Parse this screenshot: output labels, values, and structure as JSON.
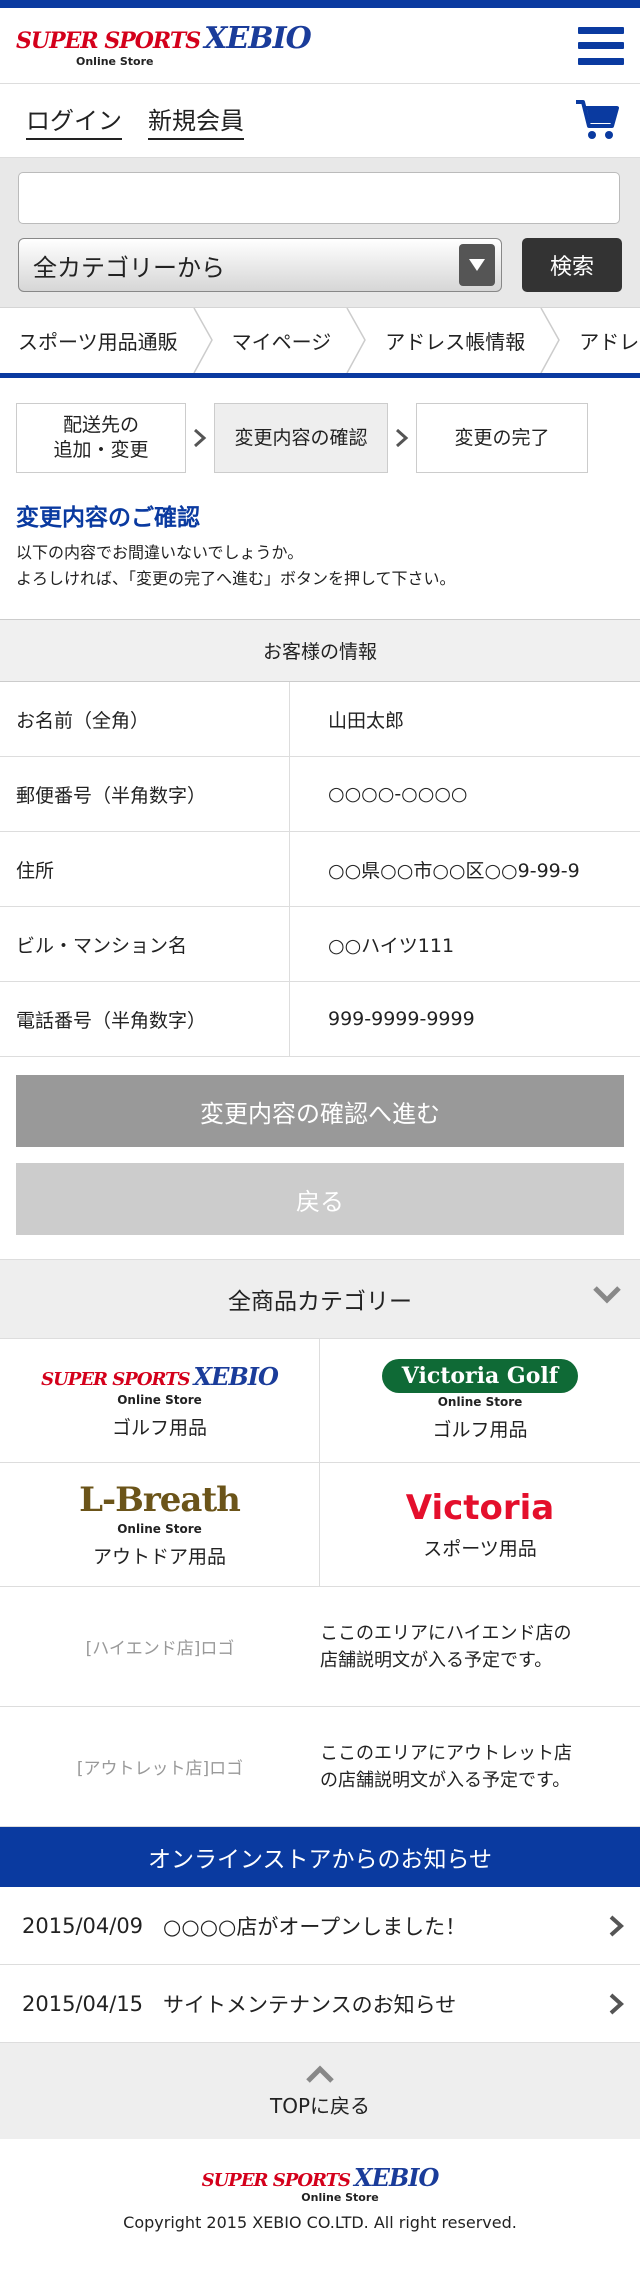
{
  "header": {
    "logo_super": "THE SUPER SPORTS",
    "logo_xebio": "XEBIO",
    "logo_sub": "Online Store"
  },
  "account": {
    "login": "ログイン",
    "register": "新規会員"
  },
  "search": {
    "placeholder": "",
    "category_selected": "全カテゴリーから",
    "button": "検索"
  },
  "breadcrumb": [
    "スポーツ用品通販",
    "マイページ",
    "アドレス帳情報",
    "アドレス帳"
  ],
  "steps": {
    "step1_line1": "配送先の",
    "step1_line2": "追加・変更",
    "step2": "変更内容の確認",
    "step3": "変更の完了"
  },
  "main": {
    "title": "変更内容のご確認",
    "intro_line1": "以下の内容でお間違いないでしょうか。",
    "intro_line2": "よろしければ、「変更の完了へ進む」ボタンを押して下さい。"
  },
  "customer": {
    "heading": "お客様の情報",
    "rows": [
      {
        "label": "お名前（全角）",
        "value": "山田太郎"
      },
      {
        "label": "郵便番号（半角数字）",
        "value": "○○○○-○○○○"
      },
      {
        "label": "住所",
        "value": "○○県○○市○○区○○9-99-9"
      },
      {
        "label": "ビル・マンション名",
        "value": "○○ハイツ111"
      },
      {
        "label": "電話番号（半角数字）",
        "value": "999-9999-9999"
      }
    ]
  },
  "buttons": {
    "confirm": "変更内容の確認へ進む",
    "back": "戻る"
  },
  "categories": {
    "heading": "全商品カテゴリー",
    "brands": [
      {
        "logo": "XEBIO",
        "sub": "Online Store",
        "caption": "ゴルフ用品"
      },
      {
        "logo": "Victoria Golf",
        "sub": "Online Store",
        "caption": "ゴルフ用品"
      },
      {
        "logo": "L-Breath",
        "sub": "Online Store",
        "caption": "アウトドア用品"
      },
      {
        "logo": "Victoria",
        "sub": "",
        "caption": "スポーツ用品"
      }
    ],
    "stores": [
      {
        "logo": "[ハイエンド店]ロゴ",
        "desc_line1": "ここのエリアにハイエンド店の",
        "desc_line2": "店舗説明文が入る予定です。"
      },
      {
        "logo": "[アウトレット店]ロゴ",
        "desc_line1": "ここのエリアにアウトレット店",
        "desc_line2": "の店舗説明文が入る予定です。"
      }
    ]
  },
  "news": {
    "heading": "オンラインストアからのお知らせ",
    "items": [
      {
        "date": "2015/04/09",
        "text": "○○○○店がオープンしました！"
      },
      {
        "date": "2015/04/15",
        "text": "サイトメンテナンスのお知らせ"
      }
    ]
  },
  "footer": {
    "to_top": "TOPに戻る",
    "copyright": "Copyright 2015 XEBIO CO.LTD. All right reserved."
  },
  "colors": {
    "brand_blue": "#0a3aa0",
    "brand_red": "#d4001b"
  }
}
